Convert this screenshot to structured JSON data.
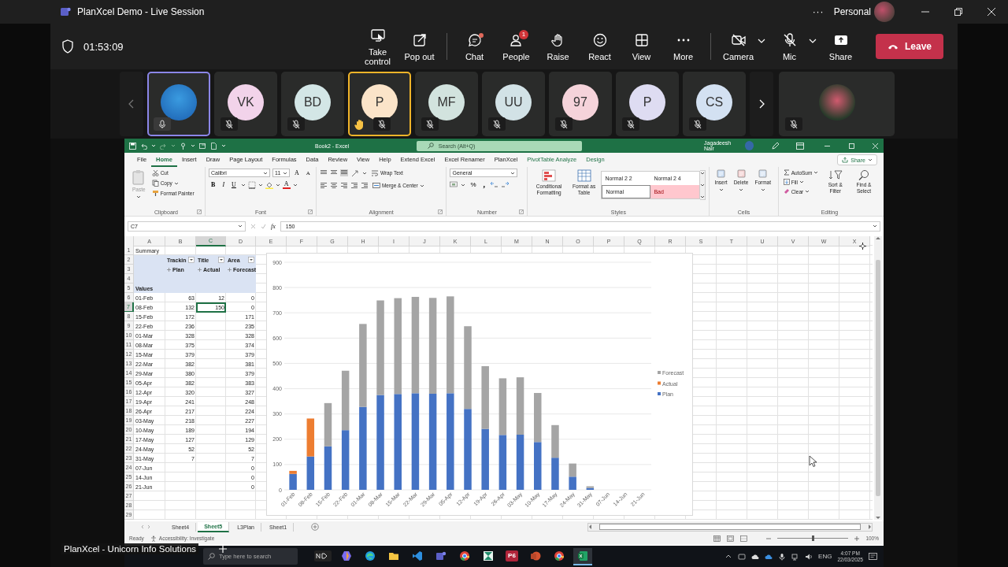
{
  "window": {
    "title": "PlanXcel Demo - Live Session",
    "more": "···",
    "account": "Personal"
  },
  "meeting": {
    "timer": "01:53:09",
    "action_groups": [
      [
        {
          "label": "Take control",
          "kind": "take-control"
        },
        {
          "label": "Pop out",
          "kind": "pop-out"
        }
      ],
      [
        {
          "label": "Chat",
          "kind": "chat",
          "unread": true
        },
        {
          "label": "People",
          "kind": "people",
          "badge": "1"
        },
        {
          "label": "Raise",
          "kind": "raise"
        },
        {
          "label": "React",
          "kind": "react"
        },
        {
          "label": "View",
          "kind": "view"
        },
        {
          "label": "More",
          "kind": "more"
        }
      ],
      [
        {
          "label": "Camera",
          "kind": "camera",
          "on": false
        },
        {
          "label": "Mic",
          "kind": "mic",
          "on": false
        },
        {
          "label": "Share",
          "kind": "share"
        }
      ]
    ],
    "leave": "Leave"
  },
  "participants": [
    {
      "kind": "photo",
      "muted": false,
      "speaking": true,
      "hand_raised": false
    },
    {
      "kind": "initials",
      "initials": "VK",
      "color": "#f2d3ea",
      "muted": true,
      "speaking": false,
      "hand_raised": false
    },
    {
      "kind": "initials",
      "initials": "BD",
      "color": "#d3e6e6",
      "muted": true,
      "speaking": false,
      "hand_raised": false
    },
    {
      "kind": "initials",
      "initials": "P",
      "color": "#fbe4c9",
      "muted": true,
      "speaking": false,
      "hand_raised": true
    },
    {
      "kind": "initials",
      "initials": "MF",
      "color": "#d2e3de",
      "muted": true,
      "speaking": false,
      "hand_raised": false
    },
    {
      "kind": "initials",
      "initials": "UU",
      "color": "#d2e2e6",
      "muted": true,
      "speaking": false,
      "hand_raised": false
    },
    {
      "kind": "initials",
      "initials": "97",
      "color": "#f5d3da",
      "muted": true,
      "speaking": false,
      "hand_raised": false
    },
    {
      "kind": "initials",
      "initials": "P",
      "color": "#dedcf2",
      "muted": true,
      "speaking": false,
      "hand_raised": false
    },
    {
      "kind": "initials",
      "initials": "CS",
      "color": "#d3e1f2",
      "muted": true,
      "speaking": false,
      "hand_raised": false
    }
  ],
  "featured_participant": {
    "kind": "photo",
    "muted": true
  },
  "excel": {
    "title": "Book2 - Excel",
    "search": {
      "placeholder": "Search (Alt+Q)"
    },
    "user": "Jagadeesh Nair",
    "tabs": [
      {
        "label": "File",
        "selected": false,
        "contextual": false
      },
      {
        "label": "Home",
        "selected": true,
        "contextual": false
      },
      {
        "label": "Insert",
        "selected": false,
        "contextual": false
      },
      {
        "label": "Draw",
        "selected": false,
        "contextual": false
      },
      {
        "label": "Page Layout",
        "selected": false,
        "contextual": false
      },
      {
        "label": "Formulas",
        "selected": false,
        "contextual": false
      },
      {
        "label": "Data",
        "selected": false,
        "contextual": false
      },
      {
        "label": "Review",
        "selected": false,
        "contextual": false
      },
      {
        "label": "View",
        "selected": false,
        "contextual": false
      },
      {
        "label": "Help",
        "selected": false,
        "contextual": false
      },
      {
        "label": "Extend Excel",
        "selected": false,
        "contextual": false
      },
      {
        "label": "Excel Renamer",
        "selected": false,
        "contextual": false
      },
      {
        "label": "PlanXcel",
        "selected": false,
        "contextual": false
      },
      {
        "label": "PivotTable Analyze",
        "selected": false,
        "contextual": true
      },
      {
        "label": "Design",
        "selected": false,
        "contextual": true
      }
    ],
    "share": "Share",
    "ribbon": {
      "clipboard": {
        "label": "Clipboard",
        "paste": "Paste",
        "cut": "Cut",
        "copy": "Copy",
        "format_painter": "Format Painter"
      },
      "font": {
        "label": "Font",
        "family": "Calibri",
        "size": "11",
        "grow": "A",
        "shrink": "A",
        "bold": "B",
        "italic": "I",
        "underline": "U",
        "font_color": "A"
      },
      "alignment": {
        "label": "Alignment",
        "wrap": "Wrap Text",
        "merge": "Merge & Center"
      },
      "number": {
        "label": "Number",
        "format": "General",
        "percent": "%",
        "comma": ","
      },
      "styles": {
        "label": "Styles",
        "conditional": "Conditional Formatting",
        "table": "Format as Table",
        "gallery": [
          {
            "label": "Normal 2 2",
            "kind": "plain"
          },
          {
            "label": "Normal 2 4",
            "kind": "plain"
          },
          {
            "label": "Normal",
            "kind": "normal"
          },
          {
            "label": "Bad",
            "kind": "bad"
          }
        ]
      },
      "cells": {
        "label": "Cells",
        "insert": "Insert",
        "delete": "Delete",
        "format": "Format"
      },
      "editing": {
        "label": "Editing",
        "autosum": "AutoSum",
        "fill": "Fill",
        "clear": "Clear",
        "sort": "Sort & Filter",
        "find": "Find & Select"
      }
    },
    "name_box": "C7",
    "fx": "fx",
    "formula": "150",
    "columns": [
      {
        "label": "A",
        "selected": false
      },
      {
        "label": "B",
        "selected": false
      },
      {
        "label": "C",
        "selected": true
      },
      {
        "label": "D",
        "selected": false
      },
      {
        "label": "E",
        "selected": false
      },
      {
        "label": "F",
        "selected": false
      },
      {
        "label": "G",
        "selected": false
      },
      {
        "label": "H",
        "selected": false
      },
      {
        "label": "I",
        "selected": false
      },
      {
        "label": "J",
        "selected": false
      },
      {
        "label": "K",
        "selected": false
      },
      {
        "label": "L",
        "selected": false
      },
      {
        "label": "M",
        "selected": false
      },
      {
        "label": "N",
        "selected": false
      },
      {
        "label": "O",
        "selected": false
      },
      {
        "label": "P",
        "selected": false
      },
      {
        "label": "Q",
        "selected": false
      },
      {
        "label": "R",
        "selected": false
      },
      {
        "label": "S",
        "selected": false
      },
      {
        "label": "T",
        "selected": false
      },
      {
        "label": "U",
        "selected": false
      },
      {
        "label": "V",
        "selected": false
      },
      {
        "label": "W",
        "selected": false
      },
      {
        "label": "X",
        "selected": false
      }
    ],
    "rows": [
      {
        "number": "1",
        "selected": false,
        "pivot": false,
        "cells": {
          "a": {
            "text": "Summary",
            "kind": "text",
            "selected": false
          }
        }
      },
      {
        "number": "2",
        "selected": false,
        "pivot": true,
        "cells": {
          "b": {
            "text": "Trackin",
            "kind": "filter",
            "selected": false
          },
          "c": {
            "text": "Title",
            "kind": "filter",
            "selected": false
          },
          "d": {
            "text": "Area",
            "kind": "filter",
            "selected": false
          }
        }
      },
      {
        "number": "3",
        "selected": false,
        "pivot": true,
        "cells": {
          "b": {
            "text": "Plan",
            "kind": "expand",
            "selected": false
          },
          "c": {
            "text": "Actual",
            "kind": "expand",
            "selected": false
          },
          "d": {
            "text": "Forecast",
            "kind": "expand",
            "selected": false
          }
        }
      },
      {
        "number": "4",
        "selected": false,
        "pivot": true,
        "cells": {}
      },
      {
        "number": "5",
        "selected": false,
        "pivot": true,
        "cells": {
          "a": {
            "text": "Values",
            "kind": "header",
            "selected": false
          }
        }
      },
      {
        "number": "6",
        "selected": false,
        "pivot": false,
        "cells": {
          "a": {
            "text": "01-Feb",
            "kind": "text",
            "selected": false
          },
          "b": {
            "text": "63",
            "kind": "number",
            "selected": false
          },
          "c": {
            "text": "12",
            "kind": "number",
            "selected": false
          },
          "d": {
            "text": "0",
            "kind": "number",
            "selected": false
          }
        }
      },
      {
        "number": "7",
        "selected": true,
        "pivot": false,
        "cells": {
          "a": {
            "text": "08-Feb",
            "kind": "text",
            "selected": false
          },
          "b": {
            "text": "132",
            "kind": "number",
            "selected": false
          },
          "c": {
            "text": "150",
            "kind": "number",
            "selected": true
          },
          "d": {
            "text": "0",
            "kind": "number",
            "selected": false
          }
        }
      },
      {
        "number": "8",
        "selected": false,
        "pivot": false,
        "cells": {
          "a": {
            "text": "15-Feb",
            "kind": "text",
            "selected": false
          },
          "b": {
            "text": "172",
            "kind": "number",
            "selected": false
          },
          "d": {
            "text": "171",
            "kind": "number",
            "selected": false
          }
        }
      },
      {
        "number": "9",
        "selected": false,
        "pivot": false,
        "cells": {
          "a": {
            "text": "22-Feb",
            "kind": "text",
            "selected": false
          },
          "b": {
            "text": "236",
            "kind": "number",
            "selected": false
          },
          "d": {
            "text": "235",
            "kind": "number",
            "selected": false
          }
        }
      },
      {
        "number": "10",
        "selected": false,
        "pivot": false,
        "cells": {
          "a": {
            "text": "01-Mar",
            "kind": "text",
            "selected": false
          },
          "b": {
            "text": "328",
            "kind": "number",
            "selected": false
          },
          "d": {
            "text": "328",
            "kind": "number",
            "selected": false
          }
        }
      },
      {
        "number": "11",
        "selected": false,
        "pivot": false,
        "cells": {
          "a": {
            "text": "08-Mar",
            "kind": "text",
            "selected": false
          },
          "b": {
            "text": "375",
            "kind": "number",
            "selected": false
          },
          "d": {
            "text": "374",
            "kind": "number",
            "selected": false
          }
        }
      },
      {
        "number": "12",
        "selected": false,
        "pivot": false,
        "cells": {
          "a": {
            "text": "15-Mar",
            "kind": "text",
            "selected": false
          },
          "b": {
            "text": "379",
            "kind": "number",
            "selected": false
          },
          "d": {
            "text": "379",
            "kind": "number",
            "selected": false
          }
        }
      },
      {
        "number": "13",
        "selected": false,
        "pivot": false,
        "cells": {
          "a": {
            "text": "22-Mar",
            "kind": "text",
            "selected": false
          },
          "b": {
            "text": "382",
            "kind": "number",
            "selected": false
          },
          "d": {
            "text": "381",
            "kind": "number",
            "selected": false
          }
        }
      },
      {
        "number": "14",
        "selected": false,
        "pivot": false,
        "cells": {
          "a": {
            "text": "29-Mar",
            "kind": "text",
            "selected": false
          },
          "b": {
            "text": "380",
            "kind": "number",
            "selected": false
          },
          "d": {
            "text": "379",
            "kind": "number",
            "selected": false
          }
        }
      },
      {
        "number": "15",
        "selected": false,
        "pivot": false,
        "cells": {
          "a": {
            "text": "05-Apr",
            "kind": "text",
            "selected": false
          },
          "b": {
            "text": "382",
            "kind": "number",
            "selected": false
          },
          "d": {
            "text": "383",
            "kind": "number",
            "selected": false
          }
        }
      },
      {
        "number": "16",
        "selected": false,
        "pivot": false,
        "cells": {
          "a": {
            "text": "12-Apr",
            "kind": "text",
            "selected": false
          },
          "b": {
            "text": "320",
            "kind": "number",
            "selected": false
          },
          "d": {
            "text": "327",
            "kind": "number",
            "selected": false
          }
        }
      },
      {
        "number": "17",
        "selected": false,
        "pivot": false,
        "cells": {
          "a": {
            "text": "19-Apr",
            "kind": "text",
            "selected": false
          },
          "b": {
            "text": "241",
            "kind": "number",
            "selected": false
          },
          "d": {
            "text": "248",
            "kind": "number",
            "selected": false
          }
        }
      },
      {
        "number": "18",
        "selected": false,
        "pivot": false,
        "cells": {
          "a": {
            "text": "26-Apr",
            "kind": "text",
            "selected": false
          },
          "b": {
            "text": "217",
            "kind": "number",
            "selected": false
          },
          "d": {
            "text": "224",
            "kind": "number",
            "selected": false
          }
        }
      },
      {
        "number": "19",
        "selected": false,
        "pivot": false,
        "cells": {
          "a": {
            "text": "03-May",
            "kind": "text",
            "selected": false
          },
          "b": {
            "text": "218",
            "kind": "number",
            "selected": false
          },
          "d": {
            "text": "227",
            "kind": "number",
            "selected": false
          }
        }
      },
      {
        "number": "20",
        "selected": false,
        "pivot": false,
        "cells": {
          "a": {
            "text": "10-May",
            "kind": "text",
            "selected": false
          },
          "b": {
            "text": "189",
            "kind": "number",
            "selected": false
          },
          "d": {
            "text": "194",
            "kind": "number",
            "selected": false
          }
        }
      },
      {
        "number": "21",
        "selected": false,
        "pivot": false,
        "cells": {
          "a": {
            "text": "17-May",
            "kind": "text",
            "selected": false
          },
          "b": {
            "text": "127",
            "kind": "number",
            "selected": false
          },
          "d": {
            "text": "129",
            "kind": "number",
            "selected": false
          }
        }
      },
      {
        "number": "22",
        "selected": false,
        "pivot": false,
        "cells": {
          "a": {
            "text": "24-May",
            "kind": "text",
            "selected": false
          },
          "b": {
            "text": "52",
            "kind": "number",
            "selected": false
          },
          "d": {
            "text": "52",
            "kind": "number",
            "selected": false
          }
        }
      },
      {
        "number": "23",
        "selected": false,
        "pivot": false,
        "cells": {
          "a": {
            "text": "31-May",
            "kind": "text",
            "selected": false
          },
          "b": {
            "text": "7",
            "kind": "number",
            "selected": false
          },
          "d": {
            "text": "7",
            "kind": "number",
            "selected": false
          }
        }
      },
      {
        "number": "24",
        "selected": false,
        "pivot": false,
        "cells": {
          "a": {
            "text": "07-Jun",
            "kind": "text",
            "selected": false
          },
          "d": {
            "text": "0",
            "kind": "number",
            "selected": false
          }
        }
      },
      {
        "number": "25",
        "selected": false,
        "pivot": false,
        "cells": {
          "a": {
            "text": "14-Jun",
            "kind": "text",
            "selected": false
          },
          "d": {
            "text": "0",
            "kind": "number",
            "selected": false
          }
        }
      },
      {
        "number": "26",
        "selected": false,
        "pivot": false,
        "cells": {
          "a": {
            "text": "21-Jun",
            "kind": "text",
            "selected": false
          },
          "d": {
            "text": "0",
            "kind": "number",
            "selected": false
          }
        }
      },
      {
        "number": "27",
        "selected": false,
        "pivot": false,
        "cells": {}
      },
      {
        "number": "28",
        "selected": false,
        "pivot": false,
        "cells": {}
      },
      {
        "number": "29",
        "selected": false,
        "pivot": false,
        "cells": {}
      }
    ],
    "chart_data": {
      "type": "bar",
      "stacked": true,
      "categories": [
        "01-Feb",
        "08-Feb",
        "15-Feb",
        "22-Feb",
        "01-Mar",
        "08-Mar",
        "15-Mar",
        "22-Mar",
        "29-Mar",
        "05-Apr",
        "12-Apr",
        "19-Apr",
        "26-Apr",
        "03-May",
        "10-May",
        "17-May",
        "24-May",
        "31-May",
        "07-Jun",
        "14-Jun",
        "21-Jun"
      ],
      "series": [
        {
          "name": "Plan",
          "color": "#4472c4",
          "values": [
            63,
            132,
            172,
            236,
            328,
            375,
            379,
            382,
            380,
            382,
            320,
            241,
            217,
            218,
            189,
            127,
            52,
            7,
            null,
            null,
            null
          ]
        },
        {
          "name": "Actual",
          "color": "#ed7d31",
          "values": [
            12,
            150,
            null,
            null,
            null,
            null,
            null,
            null,
            null,
            null,
            null,
            null,
            null,
            null,
            null,
            null,
            null,
            null,
            null,
            null,
            null
          ]
        },
        {
          "name": "Forecast",
          "color": "#a5a5a5",
          "values": [
            0,
            0,
            171,
            235,
            328,
            374,
            379,
            381,
            379,
            383,
            327,
            248,
            224,
            227,
            194,
            129,
            52,
            7,
            0,
            0,
            0
          ]
        }
      ],
      "ylim": [
        0,
        900
      ],
      "yticks": [
        0,
        100,
        200,
        300,
        400,
        500,
        600,
        700,
        800,
        900
      ],
      "grid": true,
      "legend": true
    },
    "sheets": [
      {
        "label": "Sheet4",
        "selected": false
      },
      {
        "label": "Sheet5",
        "selected": true
      },
      {
        "label": "L3Plan",
        "selected": false
      },
      {
        "label": "Sheet1",
        "selected": false
      }
    ],
    "status": {
      "ready": "Ready",
      "accessibility": "Accessibility: Investigate",
      "zoom": "100%",
      "zoom_slider": {
        "level": 0.5
      }
    }
  },
  "caption": "PlanXcel - Unicorn Info Solutions",
  "taskbar": {
    "search": {
      "placeholder": "Type here to search"
    },
    "apps": [
      {
        "kind": "widget",
        "selected": false
      },
      {
        "kind": "copilot",
        "selected": false
      },
      {
        "kind": "edge",
        "selected": false
      },
      {
        "kind": "explorer",
        "selected": false
      },
      {
        "kind": "vscode",
        "selected": false
      },
      {
        "kind": "teams",
        "selected": false
      },
      {
        "kind": "chrome",
        "selected": false
      },
      {
        "kind": "green",
        "selected": false
      },
      {
        "kind": "p6",
        "label": "P6",
        "selected": false
      },
      {
        "kind": "powerpoint",
        "selected": false
      },
      {
        "kind": "chrome",
        "selected": false
      },
      {
        "kind": "excel",
        "selected": true
      }
    ],
    "language": "ENG",
    "time": "4:07 PM",
    "date": "22/03/2025"
  }
}
